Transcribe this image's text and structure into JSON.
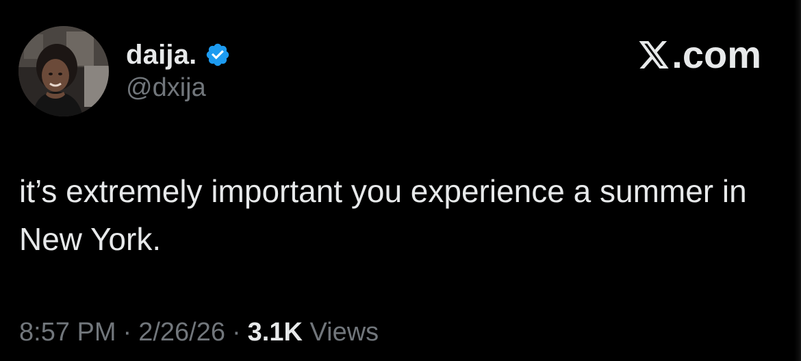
{
  "author": {
    "display_name": "daija.",
    "handle": "@dxija",
    "verified": true,
    "verified_color": "#1d9bf0"
  },
  "brand": {
    "domain_text": ".com",
    "logo_icon": "x-logo-icon"
  },
  "tweet": {
    "text": "it’s extremely important you experience a summer in New York."
  },
  "meta": {
    "time": "8:57 PM",
    "separator": "·",
    "date": "2/26/26",
    "views_count": "3.1K",
    "views_label": "Views"
  },
  "colors": {
    "background": "#000000",
    "primary_text": "#e7e9ea",
    "secondary_text": "#71767b"
  }
}
